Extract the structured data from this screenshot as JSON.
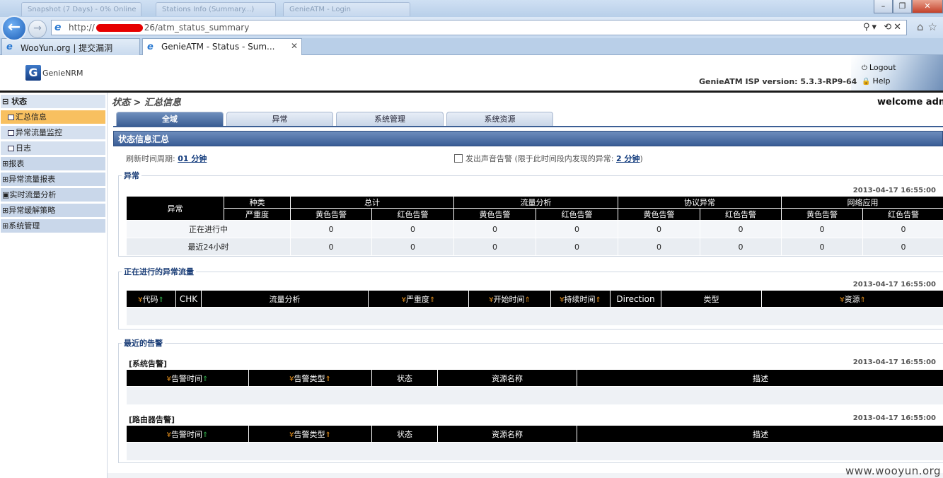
{
  "browser": {
    "ghost_tabs": [
      "Snapshot (7 Days) - 0% Online",
      "Stations Info (Summary...)",
      "GenieATM - Login"
    ],
    "window_buttons": {
      "minimize": "–",
      "maximize": "❐",
      "close": "✕"
    },
    "url_prefix": "http://",
    "url_suffix": "26/atm_status_summary",
    "tabs": [
      {
        "label": "WooYun.org | 提交漏洞",
        "active": false
      },
      {
        "label": "GenieATM - Status - Sum...",
        "active": true
      }
    ]
  },
  "header": {
    "logo_text": "GenieNRM",
    "logout": "Logout",
    "help": "Help",
    "version": "GenieATM ISP version: 5.3.3-RP9-64"
  },
  "sidebar": {
    "items": [
      {
        "label": "状态",
        "level": "top",
        "prefix": "⊟"
      },
      {
        "label": "汇总信息",
        "level": "sub",
        "selected": true
      },
      {
        "label": "异常流量监控",
        "level": "sub"
      },
      {
        "label": "日志",
        "level": "sub"
      },
      {
        "label": "报表",
        "level": "top-plain",
        "prefix": "⊞"
      },
      {
        "label": "异常流量报表",
        "level": "top-plain",
        "prefix": "⊞"
      },
      {
        "label": "实时流量分析",
        "level": "top-plain",
        "prefix": "▣"
      },
      {
        "label": "异常缓解策略",
        "level": "top-plain",
        "prefix": "⊞"
      },
      {
        "label": "系统管理",
        "level": "top-plain",
        "prefix": "⊞"
      }
    ]
  },
  "content": {
    "breadcrumb": "状态 > 汇总信息",
    "welcome": "welcome adm",
    "tabs": [
      "全域",
      "异常",
      "系统管理",
      "系统资源"
    ],
    "summary_title": "状态信息汇总",
    "refresh_label": "刷新时间周期:",
    "refresh_value": "01 分钟",
    "sound_label": "发出声音告警 (限于此时间段内发现的异常:",
    "sound_value": "2 分钟",
    "sound_close": ")"
  },
  "anomaly": {
    "legend": "异常",
    "timestamp": "2013-04-17 16:55:00",
    "row_header": "异常",
    "kind_label": "种类",
    "severity_label": "严重度",
    "groups": [
      "总计",
      "流量分析",
      "协议异常",
      "网络应用"
    ],
    "yellow": "黄色告警",
    "red": "红色告警",
    "rows": [
      {
        "label": "正在进行中",
        "values": [
          "0",
          "0",
          "0",
          "0",
          "0",
          "0",
          "0",
          "0"
        ]
      },
      {
        "label": "最近24小时",
        "values": [
          "0",
          "0",
          "0",
          "0",
          "0",
          "0",
          "0",
          "0"
        ]
      }
    ]
  },
  "ongoing": {
    "legend": "正在进行的异常流量",
    "timestamp": "2013-04-17 16:55:00",
    "columns": [
      "代码",
      "CHK",
      "流量分析",
      "严重度",
      "开始时间",
      "持续时间",
      "Direction",
      "类型",
      "资源"
    ]
  },
  "recent": {
    "legend": "最近的告警",
    "system": {
      "title": "[系统告警]",
      "timestamp": "2013-04-17 16:55:00",
      "columns": [
        "告警时间",
        "告警类型",
        "状态",
        "资源名称",
        "描述"
      ]
    },
    "router": {
      "title": "[路由器告警]",
      "timestamp": "2013-04-17 16:55:00",
      "columns": [
        "告警时间",
        "告警类型",
        "状态",
        "资源名称",
        "描述"
      ]
    }
  },
  "watermark": "www.wooyun.org"
}
